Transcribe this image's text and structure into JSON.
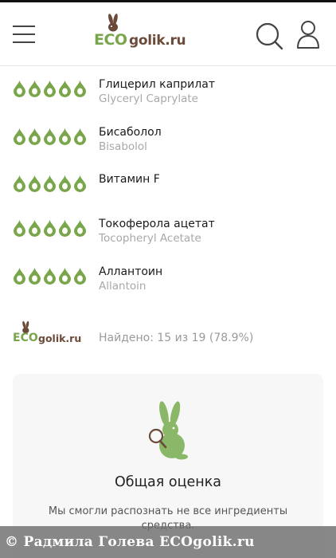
{
  "header": {
    "logo_eco": "ECO",
    "logo_golik": "golik.ru"
  },
  "ingredients": [
    {
      "name_ru": "Глицерил каприлат",
      "name_en": "Glyceryl Caprylate",
      "rating": 5
    },
    {
      "name_ru": "Бисаболол",
      "name_en": "Bisabolol",
      "rating": 5
    },
    {
      "name_ru": "Витамин F",
      "name_en": "",
      "rating": 5
    },
    {
      "name_ru": "Токоферола ацетат",
      "name_en": "Tocopheryl Acetate",
      "rating": 5
    },
    {
      "name_ru": "Аллантоин",
      "name_en": "Allantoin",
      "rating": 5
    }
  ],
  "summary": {
    "logo_eco": "ECO",
    "logo_golik": "golik.ru",
    "found_text": "Найдено: 15 из 19 (78.9%)"
  },
  "card": {
    "title": "Общая оценка",
    "text": "Мы смогли распознать не все ингредиенты средства."
  },
  "watermark": {
    "text": "© Радмила Голева ECOgolik.ru"
  },
  "colors": {
    "green": "#7aa64b",
    "brown": "#6b4a3a",
    "card_bg": "#f7f7f7"
  },
  "icons": {
    "menu": "hamburger-icon",
    "search": "search-icon",
    "user": "user-icon",
    "rating": "drop-icon",
    "mascot": "bunny-icon"
  }
}
